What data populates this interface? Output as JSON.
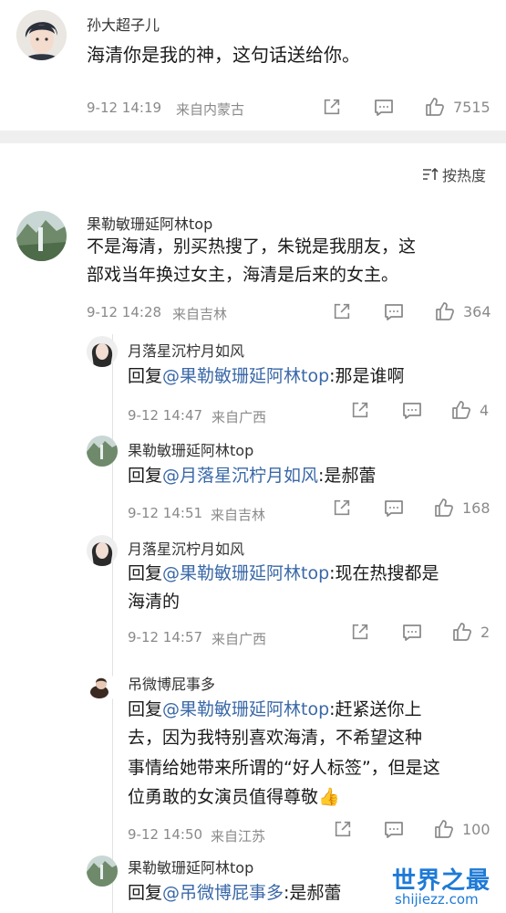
{
  "top_comment": {
    "author": "孙大超子儿",
    "text": "海清你是我的神，这句话送给你。",
    "time": "9-12 14:19",
    "location": "来自内蒙古",
    "likes": "7515"
  },
  "sort_label": "按热度",
  "main_comment": {
    "author": "果勒敏珊延阿林top",
    "text_line1": "不是海清，别买热搜了，朱锐是我朋友，这",
    "text_line2": "部戏当年换过女主，海清是后来的女主。",
    "time": "9-12 14:28",
    "location": "来自吉林",
    "likes": "364"
  },
  "replies": [
    {
      "author": "月落星沉柠月如风",
      "prefix": "回复",
      "mention": "@果勒敏珊延阿林top",
      "body_first": ":那是谁啊",
      "time": "9-12 14:47",
      "location": "来自广西",
      "likes": "4"
    },
    {
      "author": "果勒敏珊延阿林top",
      "prefix": "回复",
      "mention": "@月落星沉柠月如风",
      "body_first": ":是郝蕾",
      "time": "9-12 14:51",
      "location": "来自吉林",
      "likes": "168"
    },
    {
      "author": "月落星沉柠月如风",
      "prefix": "回复",
      "mention": "@果勒敏珊延阿林top",
      "body_first": ":现在热搜都是",
      "body_line2": "海清的",
      "time": "9-12 14:57",
      "location": "来自广西",
      "likes": "2"
    },
    {
      "author": "吊微博屁事多",
      "prefix": "回复",
      "mention": "@果勒敏珊延阿林top",
      "body_first": ":赶紧送你上",
      "body_line2": "去，因为我特别喜欢海清，不希望这种",
      "body_line3": "事情给她带来所谓的“好人标签”，但是这",
      "body_line4": "位勇敢的女演员值得尊敬👍",
      "time": "9-12 14:50",
      "location": "来自江苏",
      "likes": "100"
    },
    {
      "author": "果勒敏珊延阿林top",
      "prefix": "回复",
      "mention": "@吊微博屁事多",
      "body_first": ":是郝蕾"
    }
  ],
  "watermark": {
    "title": "世界之最",
    "url": "shijiezz.com"
  }
}
